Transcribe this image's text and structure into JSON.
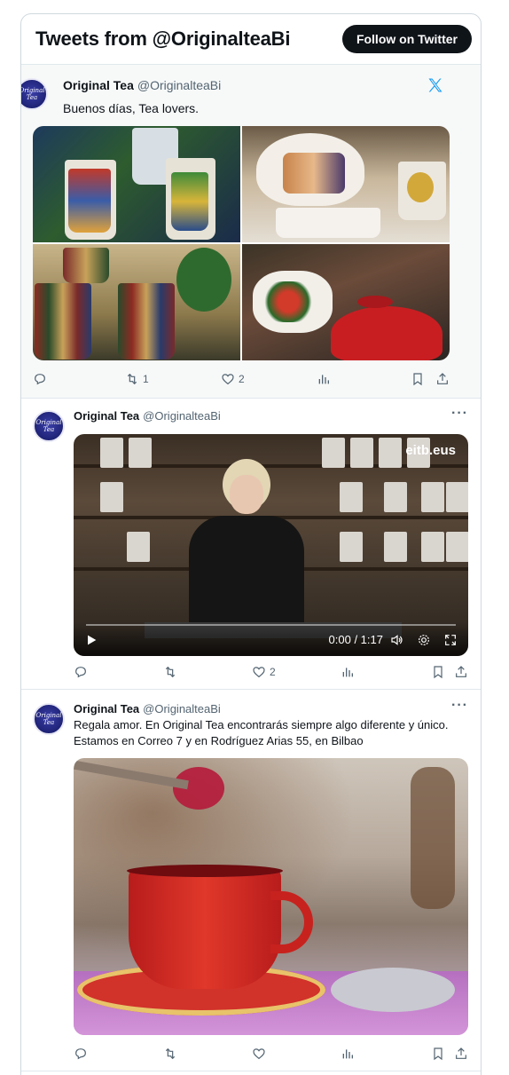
{
  "header": {
    "title": "Tweets from @OriginalteaBi",
    "follow_label": "Follow on Twitter"
  },
  "avatar_text": "Original Tea",
  "tweets": [
    {
      "name": "Original Tea",
      "handle": "@OriginalteaBi",
      "text": "Buenos días, Tea lovers.",
      "replies": "",
      "retweets": "1",
      "likes": "2"
    },
    {
      "name": "Original Tea",
      "handle": "@OriginalteaBi",
      "text": "",
      "video_time": "0:00 / 1:17",
      "video_watermark": "eitb.eus",
      "replies": "",
      "retweets": "",
      "likes": "2"
    },
    {
      "name": "Original Tea",
      "handle": "@OriginalteaBi",
      "text_line1": "Regala amor. En Original Tea encontrarás siempre algo diferente y único.",
      "text_line2": "Estamos en Correo 7 y en Rodríguez Arias 55, en Bilbao",
      "replies": "",
      "retweets": "",
      "likes": ""
    }
  ],
  "more_label": "···",
  "colors": {
    "x_brand": "#1d9bf0",
    "muted": "#536471",
    "follow_bg": "#0f1419"
  }
}
